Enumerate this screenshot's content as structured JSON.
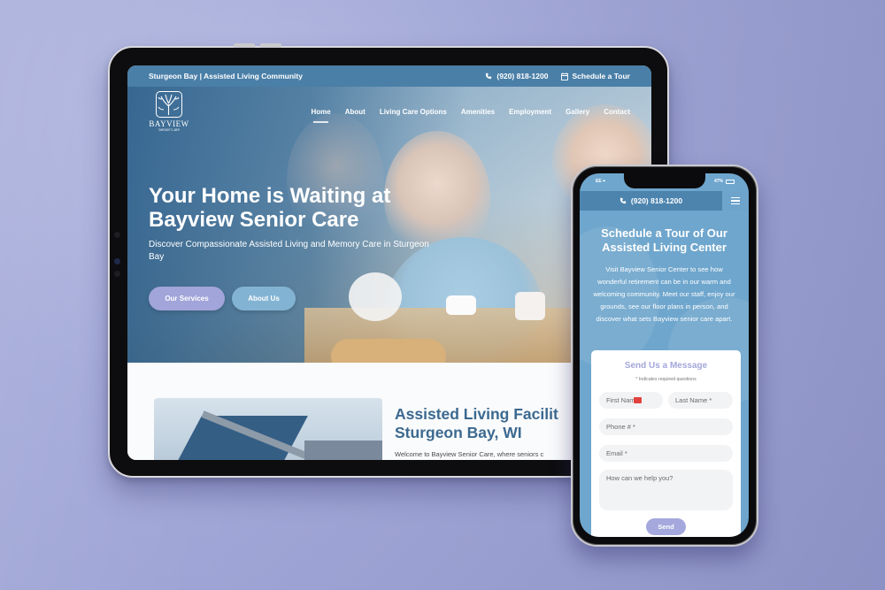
{
  "tablet": {
    "topbar": {
      "location": "Sturgeon Bay | Assisted Living Community",
      "phone": "(920) 818-1200",
      "schedule_tour": "Schedule a Tour",
      "phone_icon": "phone-icon",
      "calendar_icon": "calendar-icon"
    },
    "logo": {
      "name": "BAYVIEW",
      "tagline": "Senior Care",
      "icon": "tree-icon"
    },
    "nav": {
      "items": [
        {
          "label": "Home",
          "active": true
        },
        {
          "label": "About",
          "active": false
        },
        {
          "label": "Living Care Options",
          "active": false
        },
        {
          "label": "Amenities",
          "active": false
        },
        {
          "label": "Employment",
          "active": false
        },
        {
          "label": "Gallery",
          "active": false
        },
        {
          "label": "Contact",
          "active": false
        }
      ]
    },
    "hero": {
      "title": "Your Home is Waiting at Bayview Senior Care",
      "subtitle": "Discover Compassionate Assisted Living and Memory Care in Sturgeon Bay",
      "buttons": {
        "services": "Our Services",
        "about": "About Us"
      }
    },
    "intro": {
      "title_line1": "Assisted Living Facilit",
      "title_line2": "Sturgeon Bay, WI",
      "text": "Welcome to Bayview Senior Care, where seniors c"
    }
  },
  "phone": {
    "status": {
      "carrier": "EE",
      "battery": "47%"
    },
    "header": {
      "phone": "(920) 818-1200",
      "menu_icon": "hamburger-menu-icon"
    },
    "title": "Schedule a Tour of Our Assisted Living Center",
    "body": "Visit Bayview Senior Center to see how wonderful retirement can be in our warm and welcoming community. Meet our staff, enjoy our grounds, see our floor plans in person, and discover what sets Bayview senior care apart.",
    "form": {
      "title": "Send Us a Message",
      "note": "* Indicates required questions",
      "first_name_placeholder": "First Nam",
      "last_name_placeholder": "Last Name *",
      "phone_placeholder": "Phone # *",
      "email_placeholder": "Email *",
      "message_placeholder": "How can we help you?",
      "send_label": "Send"
    }
  },
  "colors": {
    "brand_blue": "#4a7fa7",
    "heading_blue": "#3c6990",
    "accent_lavender": "#a1a5d9",
    "accent_light_blue": "#83b3d3",
    "background": "#a2a8d8"
  }
}
